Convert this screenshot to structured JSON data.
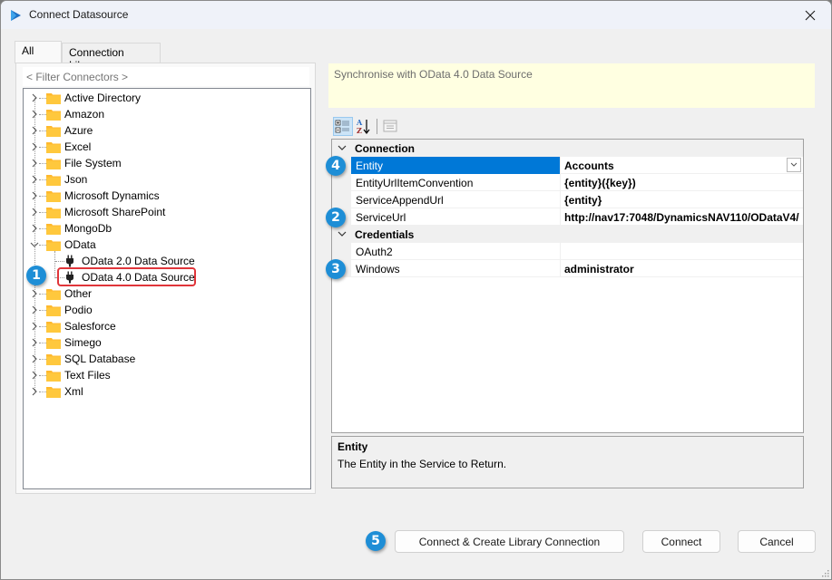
{
  "window": {
    "title": "Connect Datasource",
    "app_icon": "play-logo-icon",
    "close_icon": "close-icon"
  },
  "tabs": [
    {
      "label": "All",
      "active": true
    },
    {
      "label": "Connection Library",
      "active": false
    }
  ],
  "filter": {
    "placeholder": "< Filter Connectors >",
    "value": ""
  },
  "tree": {
    "items": [
      {
        "label": "Active Directory",
        "type": "folder",
        "expanded": false
      },
      {
        "label": "Amazon",
        "type": "folder",
        "expanded": false
      },
      {
        "label": "Azure",
        "type": "folder",
        "expanded": false
      },
      {
        "label": "Excel",
        "type": "folder",
        "expanded": false
      },
      {
        "label": "File System",
        "type": "folder",
        "expanded": false
      },
      {
        "label": "Json",
        "type": "folder",
        "expanded": false
      },
      {
        "label": "Microsoft Dynamics",
        "type": "folder",
        "expanded": false
      },
      {
        "label": "Microsoft SharePoint",
        "type": "folder",
        "expanded": false
      },
      {
        "label": "MongoDb",
        "type": "folder",
        "expanded": false
      },
      {
        "label": "OData",
        "type": "folder",
        "expanded": true,
        "children": [
          {
            "label": "OData 2.0 Data Source",
            "type": "connector"
          },
          {
            "label": "OData 4.0 Data Source",
            "type": "connector",
            "highlighted": true
          }
        ]
      },
      {
        "label": "Other",
        "type": "folder",
        "expanded": false
      },
      {
        "label": "Podio",
        "type": "folder",
        "expanded": false
      },
      {
        "label": "Salesforce",
        "type": "folder",
        "expanded": false
      },
      {
        "label": "Simego",
        "type": "folder",
        "expanded": false
      },
      {
        "label": "SQL Database",
        "type": "folder",
        "expanded": false
      },
      {
        "label": "Text Files",
        "type": "folder",
        "expanded": false
      },
      {
        "label": "Xml",
        "type": "folder",
        "expanded": false
      }
    ]
  },
  "description": "Synchronise with OData 4.0 Data Source",
  "property_toolbar": {
    "categorized_icon": "categorized-view-icon",
    "alphabetical_icon": "sort-az-icon",
    "property_pages_icon": "property-pages-icon"
  },
  "property_grid": {
    "categories": [
      {
        "name": "Connection",
        "properties": [
          {
            "name": "Entity",
            "value": "Accounts",
            "selected": true,
            "has_dropdown": true
          },
          {
            "name": "EntityUrlItemConvention",
            "value": "{entity}({key})"
          },
          {
            "name": "ServiceAppendUrl",
            "value": "{entity}"
          },
          {
            "name": "ServiceUrl",
            "value": "http://nav17:7048/DynamicsNAV110/ODataV4/"
          }
        ]
      },
      {
        "name": "Credentials",
        "properties": [
          {
            "name": "OAuth2",
            "value": ""
          },
          {
            "name": "Windows",
            "value": "administrator"
          }
        ]
      }
    ]
  },
  "help": {
    "title": "Entity",
    "text": "The Entity in the Service to Return."
  },
  "badges": [
    "1",
    "2",
    "3",
    "4",
    "5"
  ],
  "buttons": {
    "connect_create": "Connect & Create Library Connection",
    "connect": "Connect",
    "cancel": "Cancel"
  },
  "colors": {
    "accent": "#0078d7",
    "badge": "#1e8ed6",
    "highlight_border": "#e0353a",
    "folder": "#ffb92e",
    "description_bg": "#ffffe1"
  }
}
